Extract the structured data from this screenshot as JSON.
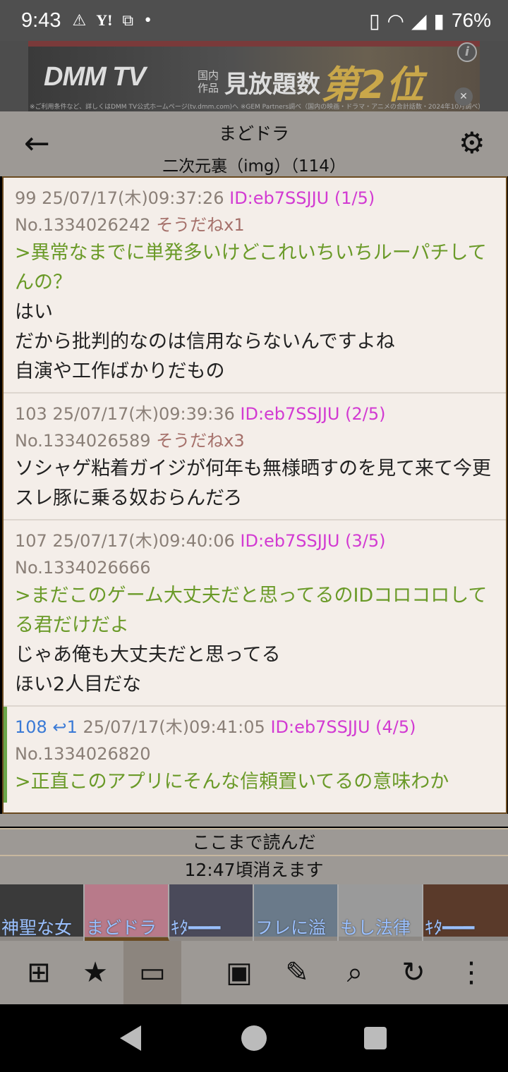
{
  "status_bar": {
    "time": "9:43",
    "battery": "76%",
    "icons": [
      "warning-icon",
      "yahoo-icon",
      "playstation-icon",
      "dot-icon"
    ],
    "right_icons": [
      "nfc-icon",
      "wifi-icon",
      "signal-icon",
      "battery-icon"
    ]
  },
  "ad": {
    "logo": "DMM TV",
    "sub_line1": "国内",
    "sub_line2": "作品",
    "main_text": "見放題数",
    "rank_text": "第2位",
    "fine_print": "※ご利用条件など、詳しくはDMM TV公式ホームページ(tv.dmm.com)へ ※GEM Partners調べ（国内の映画・ドラマ・アニメの合計話数・2024年10月調べ）"
  },
  "toolbar": {
    "title": "まどドラ",
    "subtitle": "二次元裏（img）（114）"
  },
  "posts": [
    {
      "header": "99 25/07/17(木)09:37:26",
      "id": "ID:eb7SSJJU (1/5)",
      "no": "No.1334026242",
      "sodane": "そうだねx1",
      "quote": ">異常なまでに単発多いけどこれいちいちルーパチしてんの？",
      "lines": [
        "はい",
        "だから批判的なのは信用ならないんですよね",
        "自演や工作ばかりだもの"
      ]
    },
    {
      "header": "103 25/07/17(木)09:39:36",
      "id": "ID:eb7SSJJU (2/5)",
      "no": "No.1334026589",
      "sodane": "そうだねx3",
      "quote": "",
      "lines": [
        "ソシャゲ粘着ガイジが何年も無様晒すのを見て来て今更スレ豚に乗る奴おらんだろ"
      ]
    },
    {
      "header": "107 25/07/17(木)09:40:06",
      "id": "ID:eb7SSJJU (3/5)",
      "no": "No.1334026666",
      "sodane": "",
      "quote": ">まだこのゲーム大丈夫だと思ってるのIDコロコロしてる君だけだよ",
      "lines": [
        "じゃあ俺も大丈夫だと思ってる",
        "ほい2人目だな"
      ]
    },
    {
      "num": "108",
      "reply_count": "1",
      "header": "25/07/17(木)09:41:05",
      "id": "ID:eb7SSJJU (4/5)",
      "no": "No.1334026820",
      "sodane": "",
      "quote": ">正直このアプリにそんな信頼置いてるの意味わか",
      "lines": []
    }
  ],
  "footer": {
    "read_here": "ここまで読んだ",
    "expire": "12:47頃消えます"
  },
  "tabs": [
    {
      "label": "神聖な女",
      "color": "#3a3a3a"
    },
    {
      "label": "まどドラ",
      "color": "#b87a8a"
    },
    {
      "label": "ｷﾀ━━━",
      "color": "#4a4a5a"
    },
    {
      "label": "フレに溢",
      "color": "#6a7a8a"
    },
    {
      "label": "もし法律",
      "color": "#9a9a9a"
    },
    {
      "label": "ｷﾀ━━━",
      "color": "#5a3a2a"
    }
  ],
  "bottom_nav": [
    "tree-icon",
    "star-icon",
    "window-icon",
    "gallery-icon",
    "pencil-icon",
    "search-icon",
    "refresh-icon",
    "more-icon"
  ]
}
